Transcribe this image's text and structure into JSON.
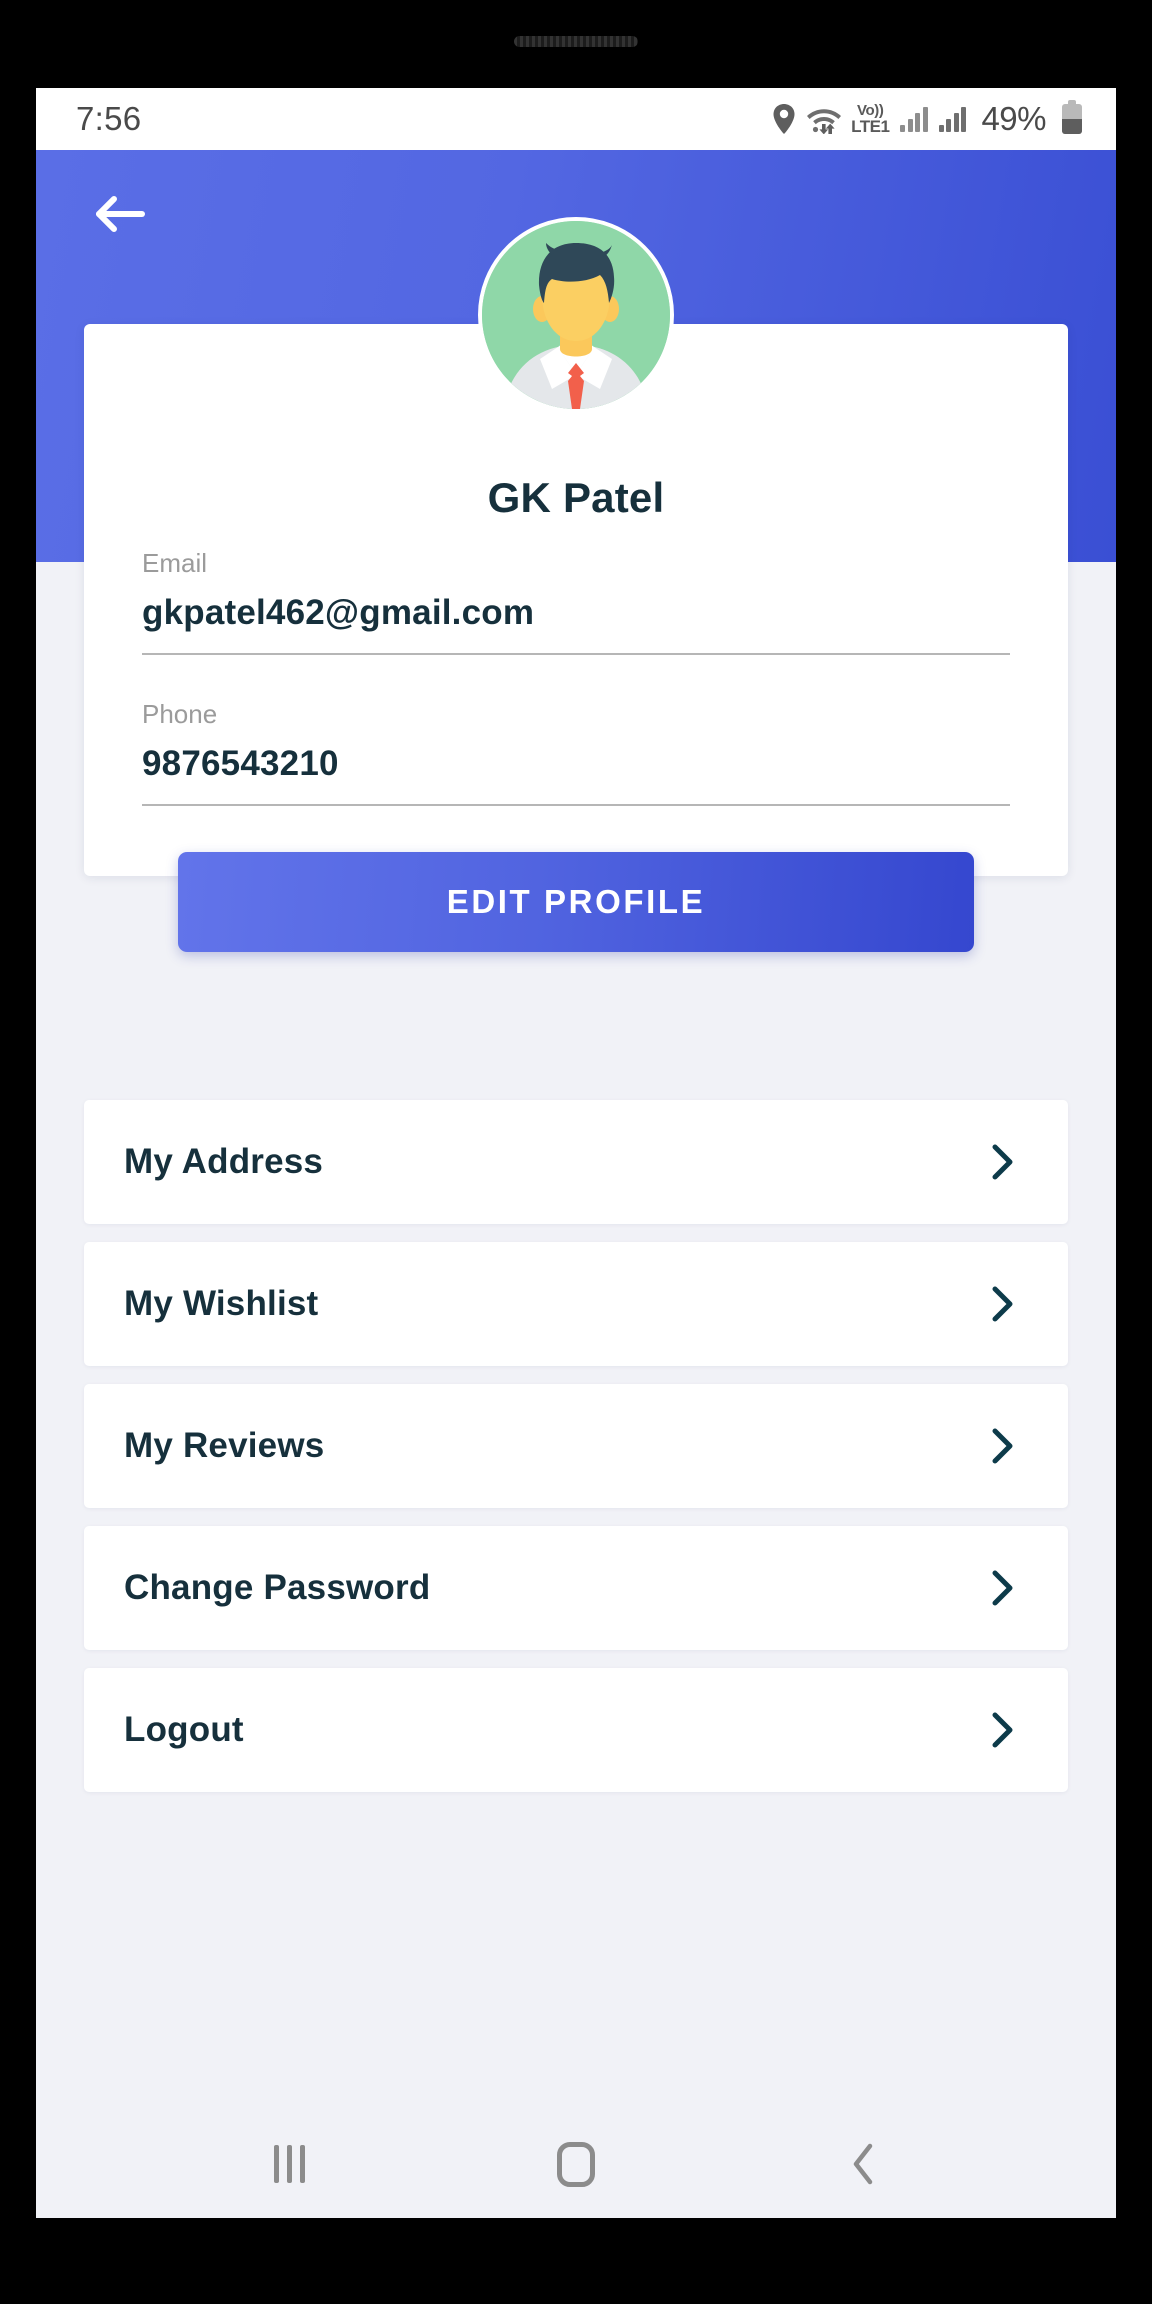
{
  "status_bar": {
    "time": "7:56",
    "battery_percent": "49%",
    "network_label_top": "Vo))",
    "network_label_bottom": "LTE1",
    "icons": [
      "location-pin-icon",
      "wifi-icon",
      "volte-icon",
      "signal-bars-icon",
      "signal-bars-icon",
      "battery-icon"
    ]
  },
  "header": {
    "back_icon": "back-arrow-icon",
    "background_color": "#5367e2"
  },
  "profile": {
    "avatar_alt": "user-avatar",
    "name": "GK Patel",
    "fields": [
      {
        "label": "Email",
        "value": "gkpatel462@gmail.com"
      },
      {
        "label": "Phone",
        "value": "9876543210"
      }
    ],
    "edit_button_label": "EDIT PROFILE"
  },
  "menu": {
    "items": [
      {
        "label": "My Address",
        "chevron": "chevron-right-icon"
      },
      {
        "label": "My Wishlist",
        "chevron": "chevron-right-icon"
      },
      {
        "label": "My Reviews",
        "chevron": "chevron-right-icon"
      },
      {
        "label": "Change Password",
        "chevron": "chevron-right-icon"
      },
      {
        "label": "Logout",
        "chevron": "chevron-right-icon"
      }
    ]
  },
  "nav_bar": {
    "recents": "recents-icon",
    "home": "home-icon",
    "back": "back-icon"
  },
  "colors": {
    "accent_blue": "#5367e2",
    "page_background": "#F1F2F7",
    "text_dark": "#16303c",
    "label_gray": "#9b9b9b",
    "avatar_bg_green": "#8FD7A8"
  }
}
